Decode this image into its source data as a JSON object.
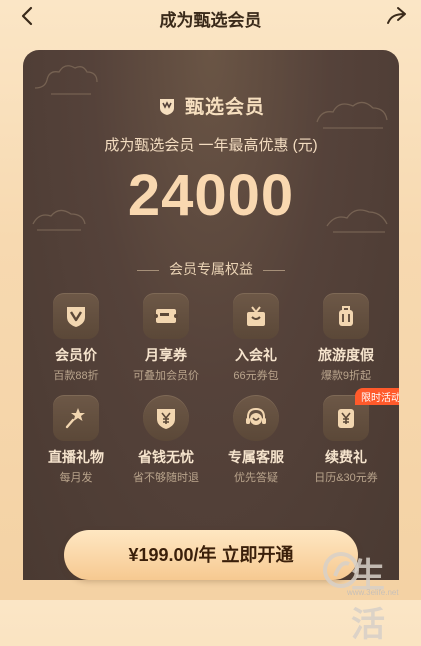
{
  "header": {
    "title": "成为甄选会员"
  },
  "hero": {
    "brand": "甄选会员",
    "subtitle": "成为甄选会员 一年最高优惠 (元)",
    "amount": "24000"
  },
  "benefits": {
    "section_title": "会员专属权益",
    "items": [
      {
        "label": "会员价",
        "sub": "百款88折",
        "icon": "v-shield-icon"
      },
      {
        "label": "月享券",
        "sub": "可叠加会员价",
        "icon": "coupon-icon"
      },
      {
        "label": "入会礼",
        "sub": "66元券包",
        "icon": "gift-icon"
      },
      {
        "label": "旅游度假",
        "sub": "爆款9折起",
        "icon": "luggage-icon"
      },
      {
        "label": "直播礼物",
        "sub": "每月发",
        "icon": "magic-wand-icon"
      },
      {
        "label": "省钱无忧",
        "sub": "省不够随时退",
        "icon": "yen-shield-icon"
      },
      {
        "label": "专属客服",
        "sub": "优先答疑",
        "icon": "headset-icon"
      },
      {
        "label": "续费礼",
        "sub": "日历&30元券",
        "icon": "yen-pouch-icon",
        "badge": "限时活动"
      }
    ]
  },
  "cta": {
    "label": "¥199.00/年 立即开通"
  },
  "watermark": {
    "text": "生活",
    "url": "www.3elife.net"
  }
}
